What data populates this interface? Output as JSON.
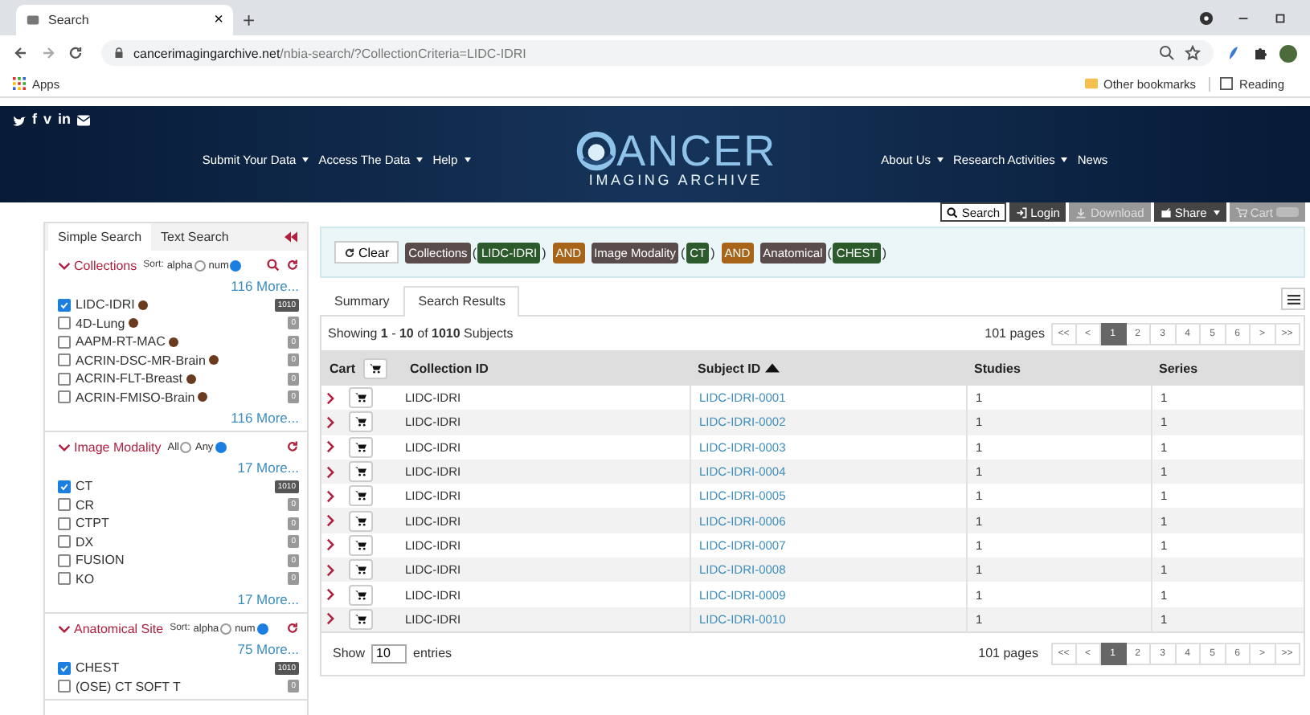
{
  "browser": {
    "tab_title": "Search",
    "new_tab": "+",
    "close": "×",
    "url_host": "cancerimagingarchive.net",
    "url_path": "/nbia-search/?CollectionCriteria=LIDC-IDRI",
    "bookmarks_left": [
      "Apps"
    ],
    "bookmarks_right": [
      "Other bookmarks",
      "Reading"
    ]
  },
  "banner": {
    "social": [
      {
        "kind": "bird"
      },
      {
        "kind": "text",
        "text": "f"
      },
      {
        "kind": "text",
        "text": "v"
      },
      {
        "kind": "text",
        "text": "in"
      },
      {
        "kind": "mail"
      }
    ],
    "nav_left": [
      {
        "label": "Submit Your Data",
        "dropdown": true
      },
      {
        "label": "Access The Data",
        "dropdown": true
      },
      {
        "label": "Help",
        "dropdown": true
      }
    ],
    "logo": {
      "word": "ANCER",
      "subtitle": "IMAGING ARCHIVE"
    },
    "nav_right": [
      {
        "label": "About Us",
        "dropdown": true
      },
      {
        "label": "Research Activities",
        "dropdown": true
      },
      {
        "label": "News",
        "dropdown": false
      }
    ]
  },
  "toolbar": [
    {
      "kind": "search",
      "label": "Search",
      "selected": true,
      "disabled": false,
      "dropdown": false
    },
    {
      "kind": "login",
      "label": "Login",
      "selected": false,
      "disabled": false,
      "dropdown": false
    },
    {
      "kind": "download",
      "label": "Download",
      "selected": false,
      "disabled": true,
      "dropdown": false
    },
    {
      "kind": "share",
      "label": "Share",
      "selected": false,
      "disabled": false,
      "dropdown": true
    },
    {
      "kind": "cart",
      "label": "Cart",
      "selected": false,
      "disabled": true,
      "dropdown": false
    }
  ],
  "sidebar": {
    "tabs": [
      {
        "label": "Simple Search",
        "selected": true
      },
      {
        "label": "Text Search",
        "selected": false
      }
    ],
    "groups": [
      {
        "title": "Collections",
        "options_label": "Sort:",
        "options": [
          {
            "label": "alpha",
            "selected": false
          },
          {
            "label": "num",
            "selected": true
          }
        ],
        "search": true,
        "more_top": "116 More...",
        "more_bottom": "116 More...",
        "items": [
          {
            "name": "LIDC-IDRI",
            "checked": true,
            "count": "1010",
            "info": true
          },
          {
            "name": "4D-Lung",
            "checked": false,
            "count": "0",
            "info": true
          },
          {
            "name": "AAPM-RT-MAC",
            "checked": false,
            "count": "0",
            "info": true
          },
          {
            "name": "ACRIN-DSC-MR-Brain",
            "checked": false,
            "count": "0",
            "info": true
          },
          {
            "name": "ACRIN-FLT-Breast",
            "checked": false,
            "count": "0",
            "info": true
          },
          {
            "name": "ACRIN-FMISO-Brain",
            "checked": false,
            "count": "0",
            "info": true
          }
        ]
      },
      {
        "title": "Image Modality",
        "options": [
          {
            "label": "All",
            "selected": false
          },
          {
            "label": "Any",
            "selected": true
          }
        ],
        "search": false,
        "more_top": "17 More...",
        "more_bottom": "17 More...",
        "items": [
          {
            "name": "CT",
            "checked": true,
            "count": "1010",
            "info": false
          },
          {
            "name": "CR",
            "checked": false,
            "count": "0",
            "info": false
          },
          {
            "name": "CTPT",
            "checked": false,
            "count": "0",
            "info": false
          },
          {
            "name": "DX",
            "checked": false,
            "count": "0",
            "info": false
          },
          {
            "name": "FUSION",
            "checked": false,
            "count": "0",
            "info": false
          },
          {
            "name": "KO",
            "checked": false,
            "count": "0",
            "info": false
          }
        ]
      },
      {
        "title": "Anatomical Site",
        "options_label": "Sort:",
        "options": [
          {
            "label": "alpha",
            "selected": false
          },
          {
            "label": "num",
            "selected": true
          }
        ],
        "search": false,
        "more_top": "75 More...",
        "items": [
          {
            "name": "CHEST",
            "checked": true,
            "count": "1010",
            "info": false
          },
          {
            "name": "(OSE) CT SOFT T",
            "checked": false,
            "count": "0",
            "info": false
          }
        ]
      }
    ]
  },
  "filter": {
    "clear": "Clear",
    "items": [
      {
        "kind": "field",
        "text": "Collections"
      },
      {
        "kind": "paren",
        "text": "("
      },
      {
        "kind": "value",
        "text": "LIDC-IDRI"
      },
      {
        "kind": "paren",
        "text": ")"
      },
      {
        "kind": "op",
        "text": "AND"
      },
      {
        "kind": "field",
        "text": "Image Modality"
      },
      {
        "kind": "paren",
        "text": "("
      },
      {
        "kind": "value",
        "text": "CT"
      },
      {
        "kind": "paren",
        "text": ")"
      },
      {
        "kind": "op",
        "text": "AND"
      },
      {
        "kind": "field",
        "text": "Anatomical"
      },
      {
        "kind": "paren",
        "text": "("
      },
      {
        "kind": "value",
        "text": "CHEST"
      },
      {
        "kind": "paren",
        "text": ")"
      }
    ]
  },
  "tabs": [
    {
      "label": "Summary",
      "selected": false
    },
    {
      "label": "Search Results",
      "selected": true
    }
  ],
  "summary": "Showing **1** - **10** of **1010** Subjects",
  "pages_label": "101 pages",
  "pagination": [
    {
      "label": "<<",
      "selected": false
    },
    {
      "label": "<",
      "selected": false
    },
    {
      "label": "1",
      "selected": true
    },
    {
      "label": "2",
      "selected": false
    },
    {
      "label": "3",
      "selected": false
    },
    {
      "label": "4",
      "selected": false
    },
    {
      "label": "5",
      "selected": false
    },
    {
      "label": "6",
      "selected": false
    },
    {
      "label": ">",
      "selected": false
    },
    {
      "label": ">>",
      "selected": false
    }
  ],
  "table": {
    "columns": [
      {
        "label": "Cart",
        "kind": "cart"
      },
      {
        "label": "Collection ID",
        "kind": "text"
      },
      {
        "label": "Subject ID",
        "kind": "sorted"
      },
      {
        "label": "Studies",
        "kind": "text"
      },
      {
        "label": "Series",
        "kind": "text"
      }
    ],
    "rows": [
      [
        "",
        "LIDC-IDRI",
        "LIDC-IDRI-0001",
        "1",
        "1"
      ],
      [
        "",
        "LIDC-IDRI",
        "LIDC-IDRI-0002",
        "1",
        "1"
      ],
      [
        "",
        "LIDC-IDRI",
        "LIDC-IDRI-0003",
        "1",
        "1"
      ],
      [
        "",
        "LIDC-IDRI",
        "LIDC-IDRI-0004",
        "1",
        "1"
      ],
      [
        "",
        "LIDC-IDRI",
        "LIDC-IDRI-0005",
        "1",
        "1"
      ],
      [
        "",
        "LIDC-IDRI",
        "LIDC-IDRI-0006",
        "1",
        "1"
      ],
      [
        "",
        "LIDC-IDRI",
        "LIDC-IDRI-0007",
        "1",
        "1"
      ],
      [
        "",
        "LIDC-IDRI",
        "LIDC-IDRI-0008",
        "1",
        "1"
      ],
      [
        "",
        "LIDC-IDRI",
        "LIDC-IDRI-0009",
        "1",
        "1"
      ],
      [
        "",
        "LIDC-IDRI",
        "LIDC-IDRI-0010",
        "1",
        "1"
      ]
    ]
  },
  "footer": {
    "show": "Show",
    "entries_value": "10",
    "entries": "entries",
    "pages_label": "101 pages",
    "pagination": [
      {
        "label": "<<",
        "selected": false
      },
      {
        "label": "<",
        "selected": false
      },
      {
        "label": "1",
        "selected": true
      },
      {
        "label": "2",
        "selected": false
      },
      {
        "label": "3",
        "selected": false
      },
      {
        "label": "4",
        "selected": false
      },
      {
        "label": "5",
        "selected": false
      },
      {
        "label": "6",
        "selected": false
      },
      {
        "label": ">",
        "selected": false
      },
      {
        "label": ">>",
        "selected": false
      }
    ]
  }
}
